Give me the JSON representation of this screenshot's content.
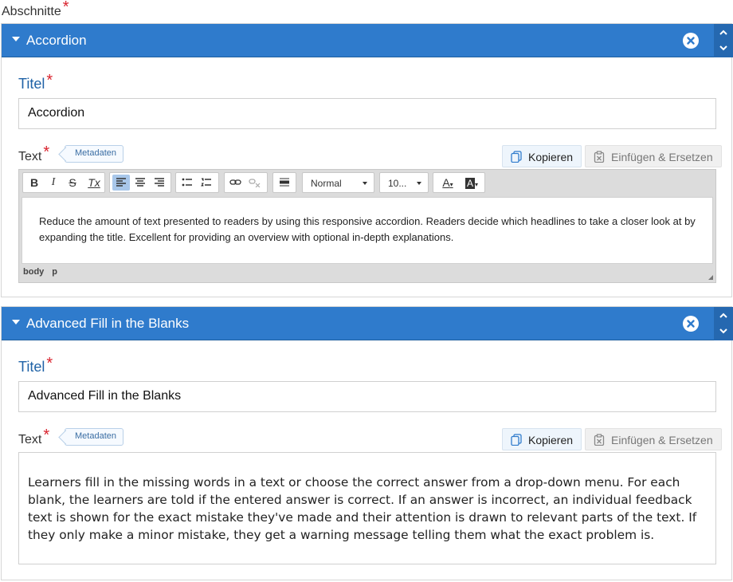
{
  "sections_label": "Abschnitte",
  "required_mark": "*",
  "colors": {
    "header_blue": "#2f7bcc",
    "label_blue": "#1f62a6",
    "required_red": "#d9232e"
  },
  "sections": [
    {
      "header_title": "Accordion",
      "title_label": "Titel",
      "title_value": "Accordion",
      "text_label": "Text",
      "metadata_label": "Metadaten",
      "copy_label": "Kopieren",
      "paste_label": "Einfügen & Ersetzen",
      "toolbar": {
        "bold": "B",
        "italic": "I",
        "strike": "S",
        "clear_format": "Tx",
        "format_select": "Normal",
        "size_select": "10...",
        "text_color": "A",
        "bg_color": "A"
      },
      "body_text": "Reduce the amount of text presented to readers by using this responsive accordion. Readers decide which headlines to take a closer look at by expanding the title. Excellent for providing an overview with optional in-depth explanations.",
      "status_path": [
        "body",
        "p"
      ]
    },
    {
      "header_title": "Advanced Fill in the Blanks",
      "title_label": "Titel",
      "title_value": "Advanced Fill in the Blanks",
      "text_label": "Text",
      "metadata_label": "Metadaten",
      "copy_label": "Kopieren",
      "paste_label": "Einfügen & Ersetzen",
      "body_text": "Learners fill in the missing words in a text or choose the correct answer from a drop-down menu. For each blank, the learners are told if the entered answer is correct. If an answer is incorrect, an individual feedback text is shown for the exact mistake they've made and their attention is drawn to relevant parts of the text. If they only make a minor mistake, they get a warning message telling them what the exact problem is."
    }
  ]
}
